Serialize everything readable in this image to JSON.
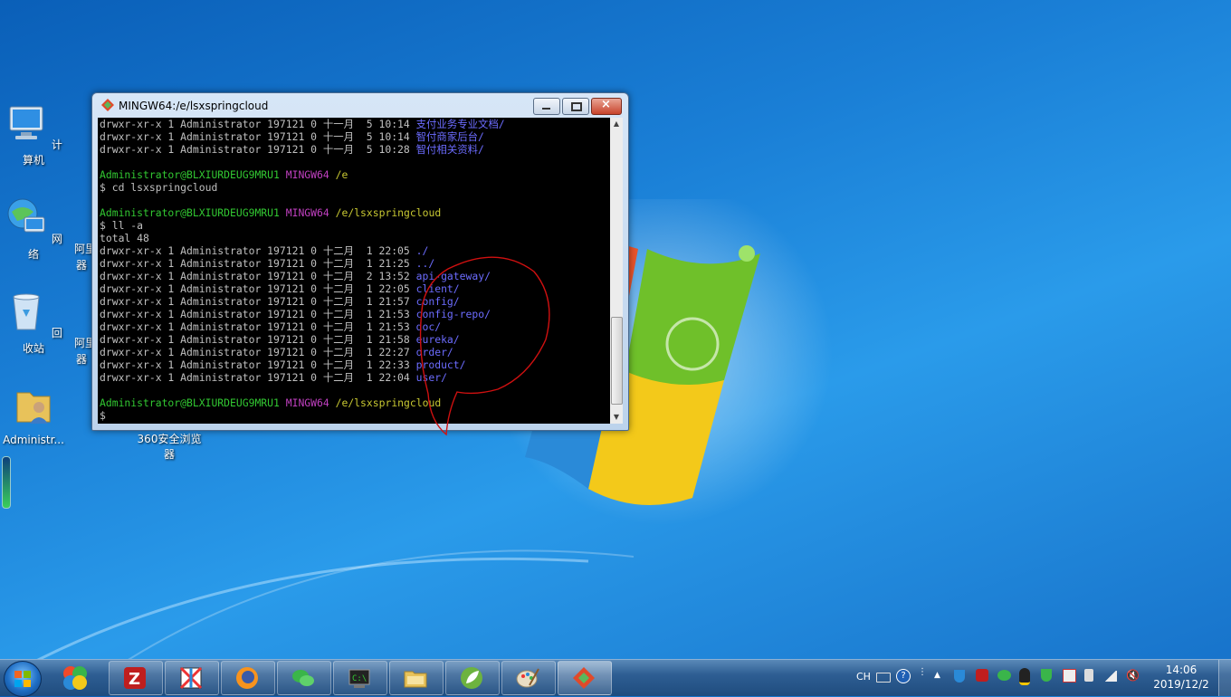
{
  "desktop": {
    "icons": [
      {
        "label": "计算机",
        "name": "computer"
      },
      {
        "label": "网络",
        "name": "network"
      },
      {
        "label": "回收站",
        "name": "recycle-bin"
      },
      {
        "label": "Administr...",
        "name": "user-folder"
      },
      {
        "label": "360安全浏览器",
        "name": "browser-360"
      }
    ],
    "partial_labels": [
      "阿里",
      "器",
      "阿里",
      "器"
    ]
  },
  "terminal": {
    "title": "MINGW64:/e/lsxspringcloud",
    "lines": [
      {
        "perm": "drwxr-xr-x 1 Administrator 197121 0 十一月  5 10:14 ",
        "name": "支付业务专业文档/"
      },
      {
        "perm": "drwxr-xr-x 1 Administrator 197121 0 十一月  5 10:14 ",
        "name": "智付商家后台/"
      },
      {
        "perm": "drwxr-xr-x 1 Administrator 197121 0 十一月  5 10:28 ",
        "name": "智付相关资料/"
      }
    ],
    "prompt_user": "Administrator@BLXIURDEUG9MRU1",
    "prompt_env": "MINGW64",
    "prompt_dir1": "/e",
    "cmd1": "$ cd lsxspringcloud",
    "prompt_dir2": "/e/lsxspringcloud",
    "cmd2": "$ ll -a",
    "total": "total 48",
    "listing": [
      {
        "perm": "drwxr-xr-x 1 Administrator 197121 0 十二月  1 22:05 ",
        "name": "./"
      },
      {
        "perm": "drwxr-xr-x 1 Administrator 197121 0 十二月  1 21:25 ",
        "name": "../"
      },
      {
        "perm": "drwxr-xr-x 1 Administrator 197121 0 十二月  2 13:52 ",
        "name": "api-gateway/"
      },
      {
        "perm": "drwxr-xr-x 1 Administrator 197121 0 十二月  1 22:05 ",
        "name": "client/"
      },
      {
        "perm": "drwxr-xr-x 1 Administrator 197121 0 十二月  1 21:57 ",
        "name": "config/"
      },
      {
        "perm": "drwxr-xr-x 1 Administrator 197121 0 十二月  1 21:53 ",
        "name": "config-repo/"
      },
      {
        "perm": "drwxr-xr-x 1 Administrator 197121 0 十二月  1 21:53 ",
        "name": "doc/"
      },
      {
        "perm": "drwxr-xr-x 1 Administrator 197121 0 十二月  1 21:58 ",
        "name": "eureka/"
      },
      {
        "perm": "drwxr-xr-x 1 Administrator 197121 0 十二月  1 22:27 ",
        "name": "order/"
      },
      {
        "perm": "drwxr-xr-x 1 Administrator 197121 0 十二月  1 22:33 ",
        "name": "product/"
      },
      {
        "perm": "drwxr-xr-x 1 Administrator 197121 0 十二月  1 22:04 ",
        "name": "user/"
      }
    ],
    "prompt_dir3": "/e/lsxspringcloud",
    "final_prompt": "$"
  },
  "taskbar": {
    "apps": [
      "360-safe-icon",
      "filezilla-icon",
      "xmind-icon",
      "firefox-icon",
      "wechat-icon",
      "cmd-icon",
      "file-explorer-icon",
      "spring-tool-icon",
      "paint-icon",
      "git-icon"
    ],
    "tray_lang": "CH",
    "time": "14:06",
    "date": "2019/12/2"
  },
  "colors": {
    "prompt_user": "#32c832",
    "prompt_env": "#c040c0",
    "prompt_dir": "#c8c832",
    "dir_names": "#6c6cff",
    "annotation": "#d01010"
  }
}
